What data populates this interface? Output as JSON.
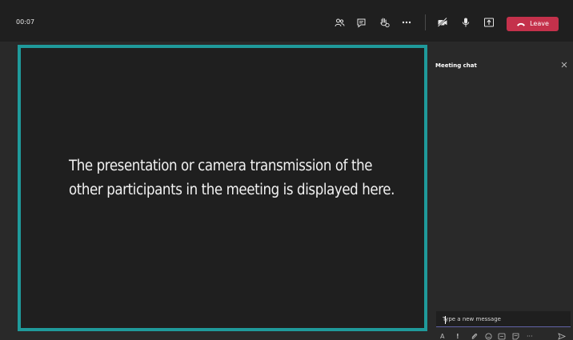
{
  "meeting": {
    "elapsed_time": "00:07",
    "leave_label": "Leave",
    "colors": {
      "accent_border": "#1f9a9b",
      "leave": "#c4314b",
      "background": "#292929",
      "panel": "#1f1f1f"
    }
  },
  "toolbar": {
    "icons": [
      "participants-icon",
      "chat-icon",
      "raise-hand-icon",
      "more-options-icon",
      "camera-off-icon",
      "microphone-icon",
      "share-screen-icon",
      "phone-hangup-icon"
    ],
    "more_label": "•••"
  },
  "stage": {
    "message": "The presentation or camera transmission of the other participants in the meeting is displayed here."
  },
  "chat": {
    "title": "Meeting chat",
    "close_label": "×",
    "input_placeholder": "Type a new message",
    "compose_tools": {
      "format": "A",
      "important": "!",
      "more": "···",
      "icons": [
        "format-icon",
        "important-icon",
        "attach-icon",
        "emoji-icon",
        "gif-icon",
        "sticker-icon",
        "more-options-icon",
        "send-icon"
      ]
    }
  }
}
